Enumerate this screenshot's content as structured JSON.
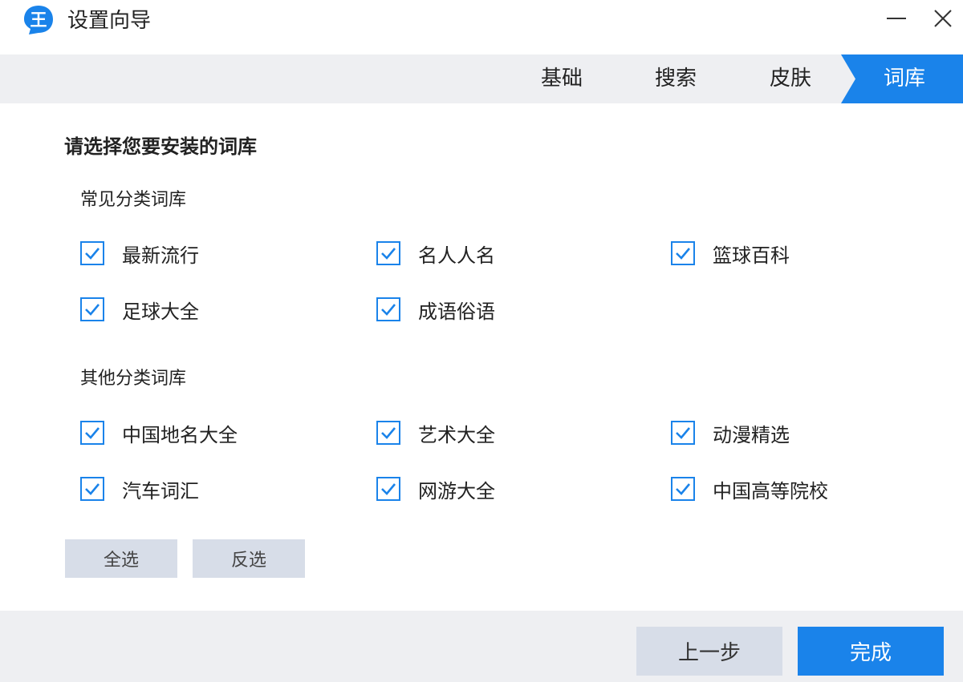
{
  "window": {
    "title": "设置向导",
    "logo_glyph": "王"
  },
  "steps": [
    {
      "label": "基础",
      "active": false
    },
    {
      "label": "搜索",
      "active": false
    },
    {
      "label": "皮肤",
      "active": false
    },
    {
      "label": "词库",
      "active": true
    }
  ],
  "content": {
    "heading": "请选择您要安装的词库",
    "groups": [
      {
        "title": "常见分类词库",
        "items": [
          {
            "label": "最新流行",
            "checked": true
          },
          {
            "label": "名人人名",
            "checked": true
          },
          {
            "label": "篮球百科",
            "checked": true
          },
          {
            "label": "足球大全",
            "checked": true
          },
          {
            "label": "成语俗语",
            "checked": true
          }
        ]
      },
      {
        "title": "其他分类词库",
        "items": [
          {
            "label": "中国地名大全",
            "checked": true
          },
          {
            "label": "艺术大全",
            "checked": true
          },
          {
            "label": "动漫精选",
            "checked": true
          },
          {
            "label": "汽车词汇",
            "checked": true
          },
          {
            "label": "网游大全",
            "checked": true
          },
          {
            "label": "中国高等院校",
            "checked": true
          }
        ]
      }
    ],
    "select_all_label": "全选",
    "invert_label": "反选"
  },
  "footer": {
    "prev_label": "上一步",
    "finish_label": "完成"
  },
  "colors": {
    "accent": "#1a83ea",
    "bar_bg": "#eeeff2",
    "button_gray": "#d7dde8"
  }
}
